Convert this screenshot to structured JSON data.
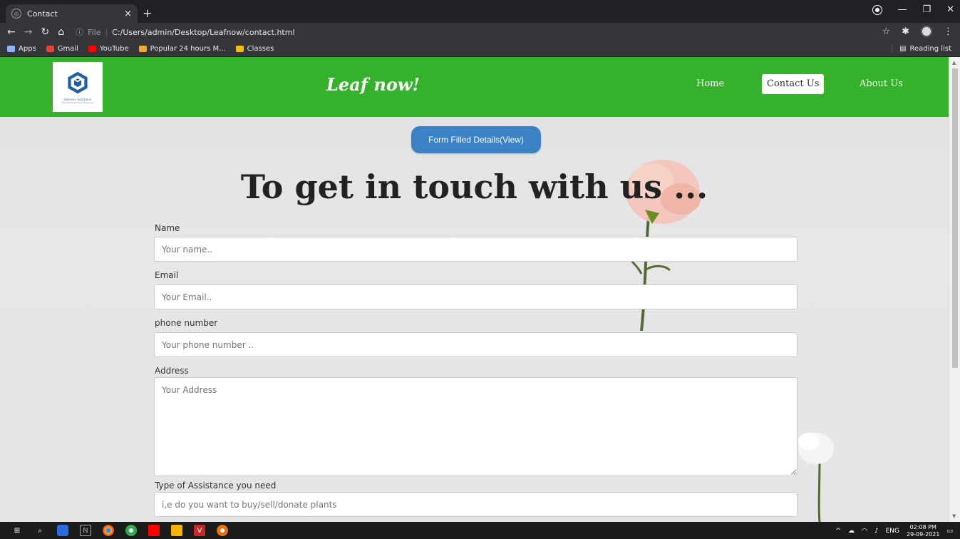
{
  "browser": {
    "tab_title": "Contact",
    "tab_close": "×",
    "new_tab": "+",
    "address_prefix": "File",
    "address_url": "C:/Users/admin/Desktop/Leafnow/contact.html",
    "bookmarks": [
      {
        "label": "Apps",
        "color": "#8ab4f8"
      },
      {
        "label": "Gmail",
        "color": "#ea4335"
      },
      {
        "label": "YouTube",
        "color": "#ff0000"
      },
      {
        "label": "Popular 24 hours M...",
        "color": "#f9a825"
      },
      {
        "label": "Classes",
        "color": "#fbbc04"
      }
    ],
    "reading_list": "Reading list"
  },
  "header": {
    "site_title": "Leaf now!",
    "logo_text": "Genesis Solutions",
    "logo_sub": "Transforming Future Business",
    "nav": [
      {
        "label": "Home",
        "active": false
      },
      {
        "label": "Contact Us",
        "active": true
      },
      {
        "label": "About Us",
        "active": false
      }
    ]
  },
  "main": {
    "view_button": "Form Filled Details(View)",
    "title": "To get in touch with us ...",
    "form": {
      "name_label": "Name",
      "name_placeholder": "Your name..",
      "email_label": "Email",
      "email_placeholder": "Your Email..",
      "phone_label": "phone number",
      "phone_placeholder": "Your phone number ..",
      "address_label": "Address",
      "address_placeholder": "Your Address",
      "assistance_label": "Type of Assistance you need",
      "assistance_placeholder": "i,e do you want to buy/sell/donate plants"
    }
  },
  "taskbar": {
    "lang": "ENG",
    "time": "02:08 PM",
    "date": "29-09-2021"
  },
  "colors": {
    "header_green": "#35b12c",
    "button_blue": "#3b82c4"
  }
}
